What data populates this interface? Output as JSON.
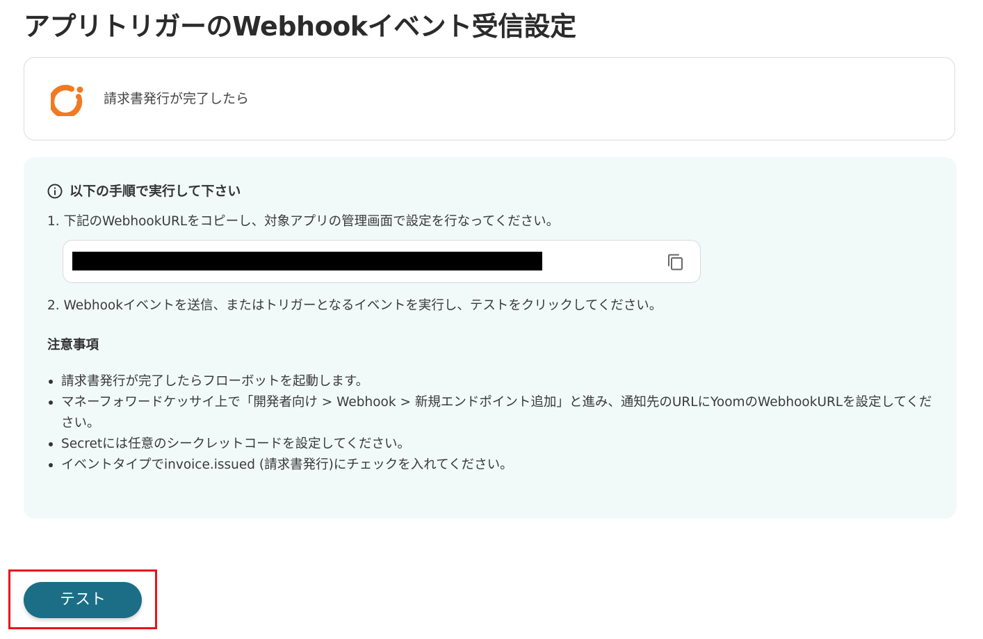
{
  "page": {
    "title": "アプリトリガーのWebhookイベント受信設定"
  },
  "trigger": {
    "app_icon": "moneyforward-logo",
    "name": "請求書発行が完了したら"
  },
  "instructions": {
    "heading_icon": "info-icon",
    "heading": "以下の手順で実行して下さい",
    "step1": "1. 下記のWebhookURLをコピーし、対象アプリの管理画面で設定を行なってください。",
    "webhook_url": "",
    "copy_icon": "copy-icon",
    "step2": "2. Webhookイベントを送信、またはトリガーとなるイベントを実行し、テストをクリックしてください。"
  },
  "notes": {
    "heading": "注意事項",
    "items": [
      "請求書発行が完了したらフローボットを起動します。",
      "マネーフォワードケッサイ上で「開発者向け > Webhook > 新規エンドポイント追加」と進み、通知先のURLにYoomのWebhookURLを設定してください。",
      "Secretには任意のシークレットコードを設定してください。",
      "イベントタイプでinvoice.issued (請求書発行)にチェックを入れてください。"
    ]
  },
  "actions": {
    "test_label": "テスト"
  },
  "colors": {
    "button": "#1b6e86",
    "panel_background": "#f2f9f9",
    "highlight": "#e8121b",
    "logo_orange": "#f07a22"
  }
}
